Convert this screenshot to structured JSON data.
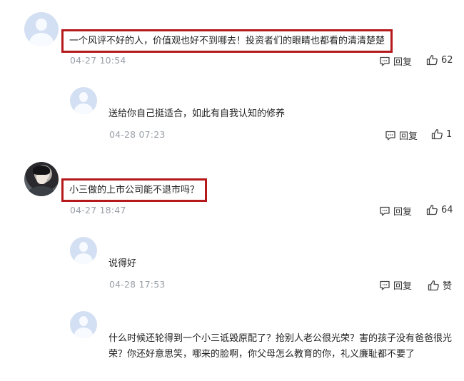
{
  "comments": [
    {
      "text": "一个风评不好的人，价值观也好不到哪去！投资者们的眼睛也都看的清清楚楚",
      "time": "04-27 10:54",
      "reply_label": "回复",
      "like_label": "62"
    },
    {
      "text": "送给你自己挺适合，如此有自我认知的修养",
      "time": "04-28 07:23",
      "reply_label": "回复",
      "like_label": "1"
    },
    {
      "text": "小三做的上市公司能不退市吗？",
      "time": "04-27 18:47",
      "reply_label": "回复",
      "like_label": "64"
    },
    {
      "text": "说得好",
      "time": "04-28 17:53",
      "reply_label": "回复",
      "like_label": "赞"
    },
    {
      "text": "什么时候还轮得到一个小三诋毁原配了？抢别人老公很光荣？害的孩子没有爸爸很光荣？你还好意思笑，哪来的脸啊，你父母怎么教育的你，礼义廉耻都不要了"
    }
  ],
  "icons": {
    "reply": "comment-bubble-icon",
    "like": "thumbs-up-icon"
  },
  "colors": {
    "highlight_border": "#b5191b",
    "timestamp": "#9aa0a8",
    "avatar_default": "#d3dff2"
  }
}
